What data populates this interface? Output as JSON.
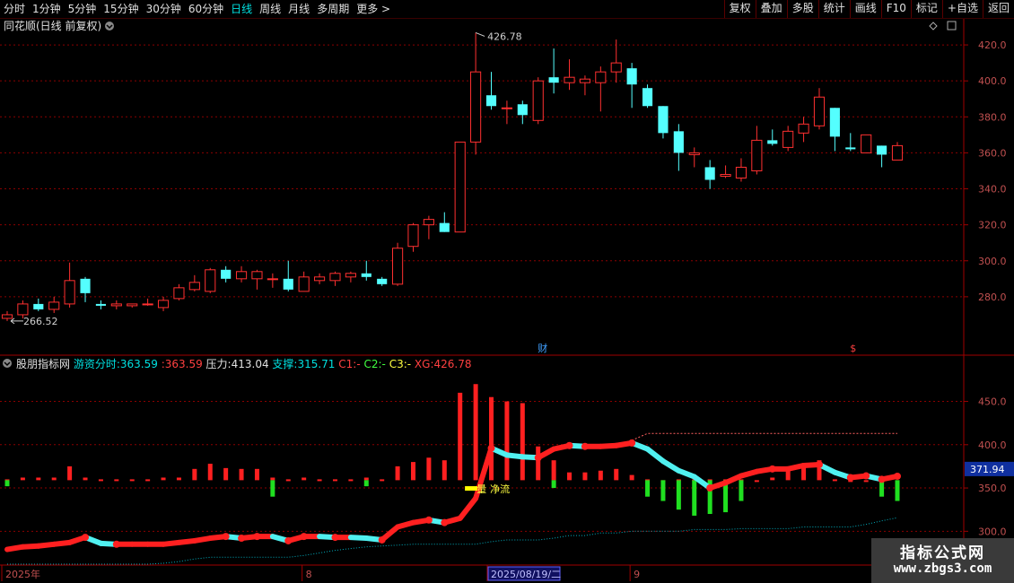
{
  "toolbar": {
    "periods": [
      "分时",
      "1分钟",
      "5分钟",
      "15分钟",
      "30分钟",
      "60分钟",
      "日线",
      "周线",
      "月线",
      "多周期",
      "更多"
    ],
    "active": "日线",
    "more_arrow": ">",
    "buttons": [
      "复权",
      "叠加",
      "多股",
      "统计",
      "画线",
      "F10",
      "标记",
      "+自选",
      "返回"
    ]
  },
  "main_panel": {
    "title": "同花顺(日线 前复权)",
    "high_label": "426.78",
    "low_label": "266.52",
    "event_marker": "财",
    "dollar_marker": "$"
  },
  "indicator_panel": {
    "name": "股朋指标网",
    "legend": [
      {
        "label": "游资分时:",
        "value": "363.59",
        "color": "#00e0e0"
      },
      {
        "label": ":",
        "value": "363.59",
        "color": "#ff4040"
      },
      {
        "label": "压力:",
        "value": "413.04",
        "color": "#e0e0e0"
      },
      {
        "label": "支撑:",
        "value": "315.71",
        "color": "#00e0e0"
      },
      {
        "label": "C1:",
        "value": "-",
        "color": "#ff4040"
      },
      {
        "label": "C2:",
        "value": "-",
        "color": "#40ff40"
      },
      {
        "label": "C3:",
        "value": "-",
        "color": "#ffff40"
      },
      {
        "label": "XG:",
        "value": "426.78",
        "color": "#ff4040"
      }
    ],
    "badge": "371.94",
    "signal_labels": [
      "量",
      "净流"
    ]
  },
  "x_axis": {
    "labels": [
      "2025年",
      "8",
      "2025/08/19/二",
      "9"
    ]
  },
  "watermark": {
    "line1": "指标公式网",
    "line2": "www.zbgs3.com"
  },
  "colors": {
    "up": "#ff3030",
    "down": "#54ffff",
    "grid": "#8b0000",
    "axis_text": "#c05050"
  },
  "chart_data": [
    {
      "type": "candlestick",
      "title": "同花顺(日线 前复权)",
      "y_ticks": [
        280,
        300,
        320,
        340,
        360,
        380,
        400,
        420
      ],
      "ylim": [
        258,
        432
      ],
      "grid": true,
      "candles": [
        {
          "o": 268,
          "h": 272,
          "l": 266.52,
          "c": 270
        },
        {
          "o": 270,
          "h": 278,
          "l": 268,
          "c": 276
        },
        {
          "o": 276,
          "h": 279,
          "l": 272,
          "c": 273
        },
        {
          "o": 273,
          "h": 280,
          "l": 271,
          "c": 277
        },
        {
          "o": 276,
          "h": 299,
          "l": 274,
          "c": 289
        },
        {
          "o": 290,
          "h": 291,
          "l": 277,
          "c": 282
        },
        {
          "o": 276,
          "h": 278,
          "l": 273,
          "c": 275
        },
        {
          "o": 275,
          "h": 278,
          "l": 273,
          "c": 276
        },
        {
          "o": 275,
          "h": 276,
          "l": 274,
          "c": 276
        },
        {
          "o": 276,
          "h": 279,
          "l": 275,
          "c": 276
        },
        {
          "o": 274,
          "h": 280,
          "l": 272,
          "c": 278
        },
        {
          "o": 279,
          "h": 287,
          "l": 278,
          "c": 285
        },
        {
          "o": 284,
          "h": 292,
          "l": 283,
          "c": 288
        },
        {
          "o": 283,
          "h": 296,
          "l": 282,
          "c": 295
        },
        {
          "o": 295,
          "h": 297,
          "l": 288,
          "c": 290
        },
        {
          "o": 290,
          "h": 297,
          "l": 288,
          "c": 294
        },
        {
          "o": 290,
          "h": 295,
          "l": 284,
          "c": 294
        },
        {
          "o": 290,
          "h": 293,
          "l": 285,
          "c": 290
        },
        {
          "o": 290,
          "h": 300,
          "l": 283,
          "c": 284
        },
        {
          "o": 283,
          "h": 294,
          "l": 283,
          "c": 291
        },
        {
          "o": 289,
          "h": 293,
          "l": 287,
          "c": 291
        },
        {
          "o": 289,
          "h": 294,
          "l": 286,
          "c": 293
        },
        {
          "o": 291,
          "h": 294,
          "l": 288,
          "c": 293
        },
        {
          "o": 293,
          "h": 300,
          "l": 289,
          "c": 291
        },
        {
          "o": 290,
          "h": 291,
          "l": 286,
          "c": 287
        },
        {
          "o": 287,
          "h": 310,
          "l": 286,
          "c": 307
        },
        {
          "o": 308,
          "h": 321,
          "l": 305,
          "c": 320
        },
        {
          "o": 320,
          "h": 325,
          "l": 312,
          "c": 323
        },
        {
          "o": 321,
          "h": 327,
          "l": 316,
          "c": 316
        },
        {
          "o": 316,
          "h": 348,
          "l": 316,
          "c": 366
        },
        {
          "o": 366,
          "h": 426.78,
          "l": 359,
          "c": 405
        },
        {
          "o": 392,
          "h": 405,
          "l": 384,
          "c": 386
        },
        {
          "o": 385,
          "h": 389,
          "l": 376,
          "c": 385
        },
        {
          "o": 387,
          "h": 389,
          "l": 376,
          "c": 381
        },
        {
          "o": 378,
          "h": 402,
          "l": 376,
          "c": 400
        },
        {
          "o": 402,
          "h": 418,
          "l": 393,
          "c": 399
        },
        {
          "o": 399,
          "h": 412,
          "l": 395,
          "c": 402
        },
        {
          "o": 399,
          "h": 403,
          "l": 392,
          "c": 401
        },
        {
          "o": 399,
          "h": 408,
          "l": 383,
          "c": 405
        },
        {
          "o": 405,
          "h": 423,
          "l": 399,
          "c": 410
        },
        {
          "o": 407,
          "h": 410,
          "l": 385,
          "c": 398
        },
        {
          "o": 396,
          "h": 398,
          "l": 385,
          "c": 386
        },
        {
          "o": 386,
          "h": 385,
          "l": 368,
          "c": 371
        },
        {
          "o": 372,
          "h": 376,
          "l": 350,
          "c": 360
        },
        {
          "o": 359,
          "h": 363,
          "l": 352,
          "c": 360
        },
        {
          "o": 352,
          "h": 356,
          "l": 340,
          "c": 345
        },
        {
          "o": 347,
          "h": 353,
          "l": 346,
          "c": 348
        },
        {
          "o": 346,
          "h": 357,
          "l": 344,
          "c": 352
        },
        {
          "o": 350,
          "h": 375,
          "l": 348,
          "c": 367
        },
        {
          "o": 367,
          "h": 373,
          "l": 364,
          "c": 365
        },
        {
          "o": 363,
          "h": 375,
          "l": 361,
          "c": 372
        },
        {
          "o": 371,
          "h": 380,
          "l": 366,
          "c": 376
        },
        {
          "o": 375,
          "h": 396,
          "l": 373,
          "c": 391
        },
        {
          "o": 385,
          "h": 385,
          "l": 361,
          "c": 369
        },
        {
          "o": 363,
          "h": 371,
          "l": 361,
          "c": 362
        },
        {
          "o": 360,
          "h": 370,
          "l": 360,
          "c": 370
        },
        {
          "o": 364,
          "h": 364,
          "l": 352,
          "c": 359
        },
        {
          "o": 356,
          "h": 366,
          "l": 356,
          "c": 364
        }
      ],
      "annotations": [
        {
          "text": "426.78",
          "candle": 30
        },
        {
          "text": "266.52",
          "candle": 0
        }
      ]
    },
    {
      "type": "line",
      "title": "股朋指标网",
      "y_ticks": [
        300,
        350,
        400,
        450
      ],
      "ylim": [
        262,
        492
      ],
      "grid": true,
      "series": [
        {
          "name": "游资分时",
          "values": [
            279,
            282,
            283,
            285,
            287,
            293,
            286,
            285,
            285,
            285,
            285,
            287,
            289,
            292,
            294,
            292,
            294,
            294,
            289,
            294,
            294,
            293,
            293,
            292,
            290,
            305,
            310,
            313,
            310,
            315,
            338,
            396,
            388,
            386,
            385,
            395,
            399,
            398,
            398,
            399,
            402,
            395,
            381,
            370,
            363,
            350,
            356,
            364,
            369,
            372,
            372,
            376,
            377,
            368,
            362,
            364,
            360,
            363.59
          ]
        },
        {
          "name": "压力",
          "values": [
            null,
            null,
            null,
            null,
            null,
            null,
            null,
            null,
            null,
            null,
            null,
            null,
            null,
            null,
            null,
            null,
            null,
            null,
            null,
            null,
            null,
            null,
            null,
            null,
            null,
            null,
            null,
            null,
            null,
            null,
            null,
            null,
            null,
            null,
            null,
            null,
            null,
            null,
            null,
            null,
            405,
            413,
            413,
            413,
            413,
            413,
            413,
            413,
            413,
            413,
            413,
            413,
            413,
            413,
            413,
            413,
            413,
            413.04
          ]
        },
        {
          "name": "支撑",
          "values": [
            262,
            262,
            262,
            262,
            262,
            262,
            262,
            262,
            262,
            262,
            263,
            265,
            268,
            270,
            270,
            270,
            270,
            270,
            270,
            272,
            275,
            278,
            280,
            282,
            283,
            284,
            285,
            285,
            285,
            285,
            285,
            288,
            290,
            290,
            290,
            292,
            295,
            295,
            298,
            298,
            300,
            300,
            300,
            300,
            302,
            302,
            302,
            303,
            303,
            303,
            303,
            305,
            305,
            305,
            305,
            308,
            312,
            315.71
          ]
        },
        {
          "name": "C1",
          "values": [
            360,
            362,
            362,
            362,
            375,
            362,
            360,
            360,
            360,
            360,
            362,
            362,
            372,
            378,
            373,
            372,
            372,
            362,
            360,
            362,
            360,
            360,
            360,
            362,
            360,
            375,
            380,
            385,
            382,
            460,
            470,
            455,
            450,
            448,
            398,
            382,
            368,
            368,
            370,
            372,
            365,
            360,
            358,
            360,
            360,
            360,
            360,
            360,
            358,
            362,
            375,
            378,
            382,
            360,
            358,
            358,
            355,
            352
          ]
        },
        {
          "name": "C2",
          "values": [
            352,
            null,
            null,
            null,
            null,
            null,
            null,
            null,
            null,
            null,
            null,
            null,
            null,
            null,
            null,
            null,
            null,
            340,
            null,
            null,
            null,
            null,
            null,
            352,
            null,
            null,
            null,
            null,
            null,
            null,
            null,
            null,
            null,
            null,
            null,
            350,
            null,
            null,
            null,
            null,
            null,
            340,
            335,
            325,
            318,
            320,
            322,
            335,
            null,
            null,
            null,
            null,
            null,
            null,
            null,
            null,
            340,
            335
          ]
        },
        {
          "name": "XG",
          "values": [
            null,
            null,
            null,
            null,
            null,
            null,
            null,
            null,
            null,
            null,
            null,
            null,
            null,
            null,
            null,
            null,
            null,
            null,
            null,
            null,
            null,
            null,
            null,
            null,
            null,
            null,
            null,
            null,
            null,
            null,
            426.78,
            null,
            null,
            null,
            null,
            null,
            null,
            null,
            null,
            null,
            null,
            null,
            null,
            null,
            null,
            null,
            null,
            null,
            null,
            null,
            null,
            null,
            null,
            null,
            null,
            null,
            null,
            null
          ]
        }
      ]
    }
  ]
}
